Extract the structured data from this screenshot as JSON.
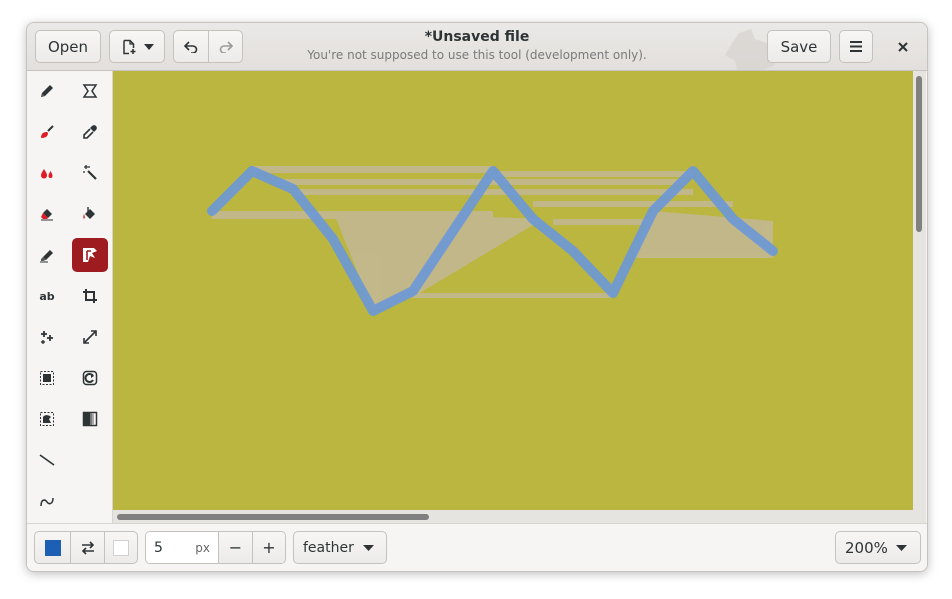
{
  "header": {
    "open_label": "Open",
    "title": "*Unsaved file",
    "subtitle": "You're not supposed to use this tool (development only).",
    "save_label": "Save"
  },
  "toolbar": {
    "tools": [
      {
        "name": "pencil-tool",
        "icon": "pencil-icon"
      },
      {
        "name": "shape-tool",
        "icon": "hourglass-shape-icon"
      },
      {
        "name": "brush-tool",
        "icon": "brush-icon"
      },
      {
        "name": "color-picker-tool",
        "icon": "eyedropper-icon"
      },
      {
        "name": "paint-tool",
        "icon": "drops-icon"
      },
      {
        "name": "magic-wand-tool",
        "icon": "magic-wand-icon"
      },
      {
        "name": "eraser-tool",
        "icon": "eraser-icon"
      },
      {
        "name": "fill-tool",
        "icon": "paint-bucket-icon"
      },
      {
        "name": "highlighter-tool",
        "icon": "highlighter-icon"
      },
      {
        "name": "freeshape-tool",
        "icon": "free-shape-icon",
        "active": true
      },
      {
        "name": "text-tool",
        "icon": "text-icon",
        "label": "ab"
      },
      {
        "name": "crop-tool",
        "icon": "crop-icon"
      },
      {
        "name": "filters-tool",
        "icon": "sparkle-icon"
      },
      {
        "name": "scale-tool",
        "icon": "expand-icon"
      },
      {
        "name": "rect-select-tool",
        "icon": "rect-select-icon"
      },
      {
        "name": "rotate-tool",
        "icon": "rotate-icon"
      },
      {
        "name": "free-select-tool",
        "icon": "free-select-icon"
      },
      {
        "name": "skew-tool",
        "icon": "gradient-icon"
      },
      {
        "name": "line-tool",
        "icon": "line-icon"
      },
      {
        "name": "curve-tool",
        "icon": "curve-icon"
      }
    ]
  },
  "bottom": {
    "size_value": "5",
    "size_unit": "px",
    "minus_label": "−",
    "plus_label": "+",
    "option_label": "feather",
    "zoom_label": "200%"
  },
  "colors": {
    "primary": "#1c5fb4",
    "secondary": "#ffffff",
    "canvas_bg": "#bbb640",
    "stroke": "#6b98d8",
    "fill": "#c6b9a0",
    "active_tool": "#9e1b1f"
  }
}
